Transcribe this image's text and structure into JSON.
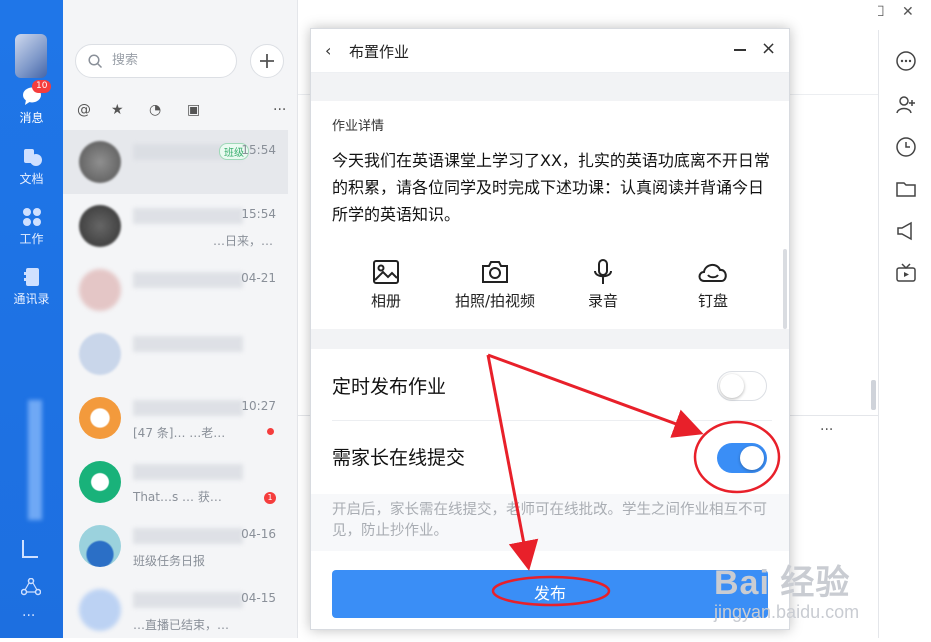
{
  "rail": {
    "messages_label": "消息",
    "messages_badge": "10",
    "docs_label": "文档",
    "work_label": "工作",
    "contacts_label": "通讯录"
  },
  "chatlist": {
    "search_placeholder": "搜索",
    "rows": [
      {
        "time": "15:54",
        "tag": "班级",
        "sub": ""
      },
      {
        "time": "15:54",
        "tag": "",
        "sub": "…日来，…"
      },
      {
        "time": "04-21",
        "tag": "",
        "sub": ""
      },
      {
        "time": "",
        "tag": "",
        "sub": ""
      },
      {
        "time": "10:27",
        "tag": "",
        "sub": "[47 条]…  …老…"
      },
      {
        "time": "",
        "tag": "",
        "sub": "That…s … 获…"
      },
      {
        "time": "04-16",
        "tag": "",
        "sub": "班级任务日报"
      },
      {
        "time": "04-15",
        "tag": "",
        "sub": "…直播已结束，…"
      }
    ],
    "unread_badge": "1"
  },
  "dialog": {
    "title": "布置作业",
    "detail_label": "作业详情",
    "detail_text": "今天我们在英语课堂上学习了XX，扎实的英语功底离不开日常的积累，请各位同学及时完成下述功课：认真阅读并背诵今日所学的英语知识。",
    "attachments": [
      "相册",
      "拍照/拍视频",
      "录音",
      "钉盘"
    ],
    "scheduled_label": "定时发布作业",
    "scheduled_on": false,
    "parent_submit_label": "需家长在线提交",
    "parent_submit_on": true,
    "hint_text": "开启后，家长需在线提交，老师可在线批改。学生之间作业相互不可见，防止抄作业。",
    "publish_label": "发布"
  },
  "watermark": {
    "brand": "Bai 经验",
    "url": "jingyan.baidu.com"
  },
  "colors": {
    "rail_blue": "#1f76e8",
    "accent": "#3a8ef6",
    "annotation_red": "#e8202a"
  }
}
